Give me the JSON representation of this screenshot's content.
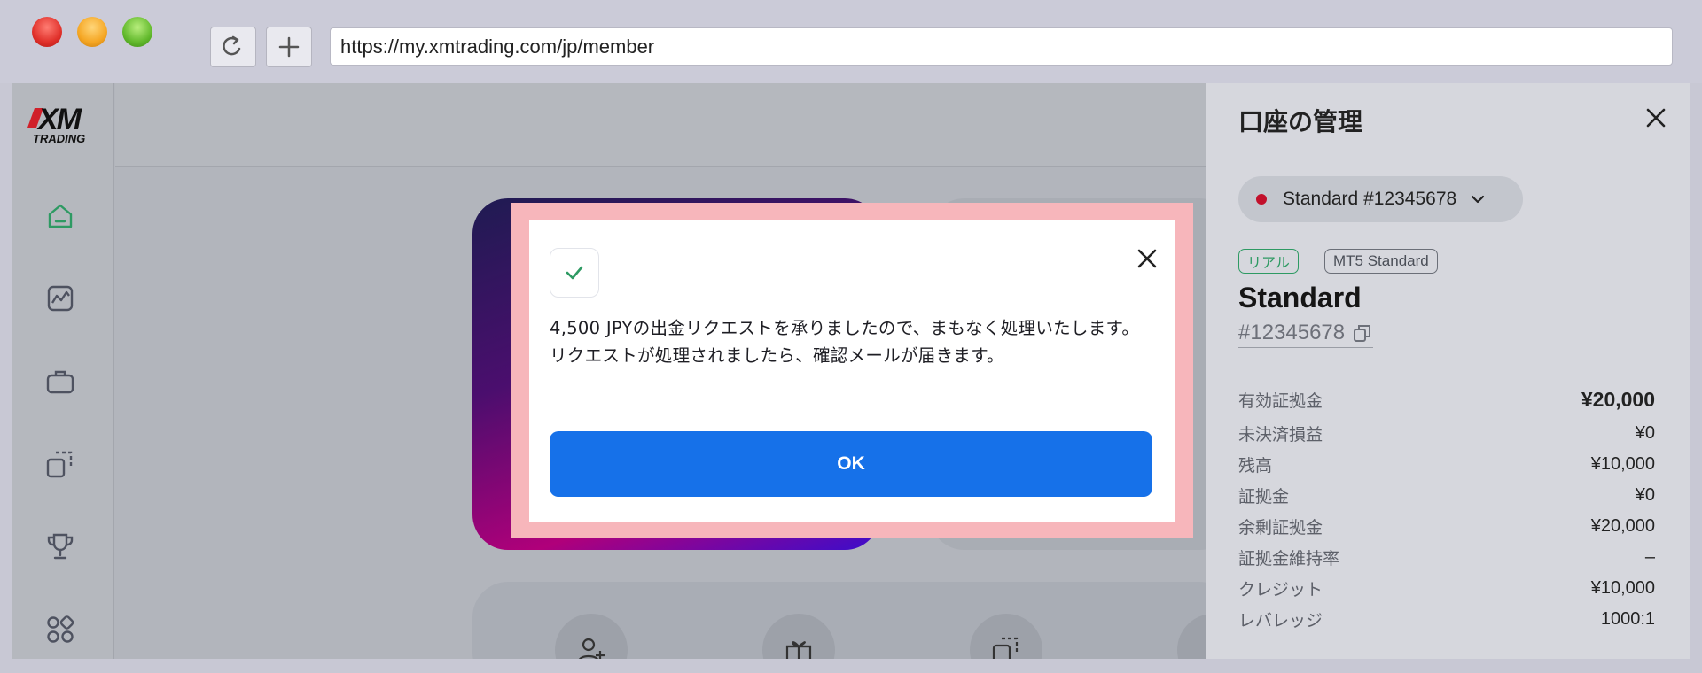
{
  "browser": {
    "url": "https://my.xmtrading.com/jp/member",
    "reload_icon": "reload-icon",
    "new_tab_icon": "plus-icon"
  },
  "logo": {
    "brand": "XM",
    "sub": "TRADING"
  },
  "sidebar": {
    "icons": [
      "home-icon",
      "chart-icon",
      "briefcase-icon",
      "copy-icon",
      "trophy-icon",
      "apps-icon"
    ]
  },
  "panel": {
    "title": "口座の管理",
    "account_selector": "Standard #12345678",
    "badge_real": "リアル",
    "badge_platform": "MT5 Standard",
    "account_name": "Standard",
    "account_number": "#12345678",
    "stats": [
      {
        "label": "有効証拠金",
        "value": "¥20,000"
      },
      {
        "label": "未決済損益",
        "value": "¥0"
      },
      {
        "label": "残高",
        "value": "¥10,000"
      },
      {
        "label": "証拠金",
        "value": "¥0"
      },
      {
        "label": "余剰証拠金",
        "value": "¥20,000"
      },
      {
        "label": "証拠金維持率",
        "value": "–"
      },
      {
        "label": "クレジット",
        "value": "¥10,000"
      },
      {
        "label": "レバレッジ",
        "value": "1000:1"
      }
    ]
  },
  "modal": {
    "message": "4,500 JPYの出金リクエストを承りましたので、まもなく処理いたします。リクエストが処理されましたら、確認メールが届きます。",
    "ok_label": "OK"
  },
  "colors": {
    "primary": "#1671e9",
    "success": "#2e9a63",
    "live_dot": "#c2102b",
    "modal_highlight": "#f7b6bb"
  }
}
